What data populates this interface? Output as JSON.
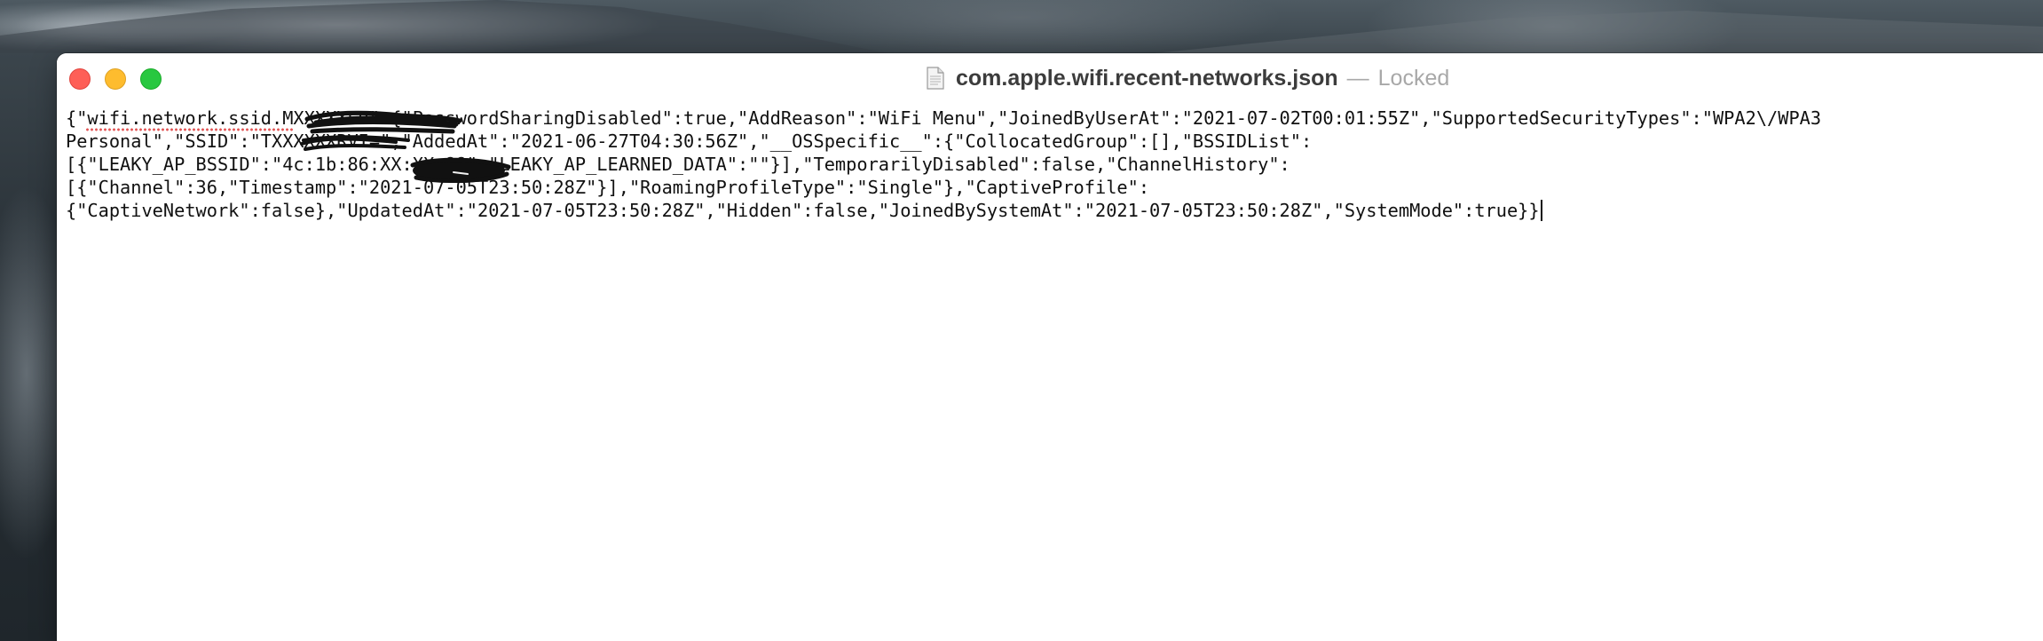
{
  "window": {
    "filename": "com.apple.wifi.recent-networks.json",
    "separator": "—",
    "status": "Locked",
    "controls": {
      "close": "close-button",
      "minimize": "minimize-button",
      "zoom": "zoom-button"
    }
  },
  "editor": {
    "lines": [
      "{\"wifi.network.ssid.MXXXXXER\":{\"PasswordSharingDisabled\":true,\"AddReason\":\"WiFi Menu\",\"JoinedByUserAt\":\"2021-07-02T00:01:55Z\",\"SupportedSecurityTypes\":\"WPA2\\/WPA3",
      "Personal\",\"SSID\":\"TXXXXXXRVI=\",\"AddedAt\":\"2021-06-27T04:30:56Z\",\"__OSSpecific__\":{\"CollocatedGroup\":[],\"BSSIDList\":",
      "[{\"LEAKY_AP_BSSID\":\"4c:1b:86:XX:XX:88\",\"LEAKY_AP_LEARNED_DATA\":\"\"}],\"TemporarilyDisabled\":false,\"ChannelHistory\":",
      "[{\"Channel\":36,\"Timestamp\":\"2021-07-05T23:50:28Z\"}],\"RoamingProfileType\":\"Single\"},\"CaptiveProfile\":",
      "{\"CaptiveNetwork\":false},\"UpdatedAt\":\"2021-07-05T23:50:28Z\",\"Hidden\":false,\"JoinedBySystemAt\":\"2021-07-05T23:50:28Z\",\"SystemMode\":true}}"
    ]
  },
  "colors": {
    "close": "#fe5f57",
    "minimize": "#febc2e",
    "zoom": "#28c840",
    "text": "#111111",
    "spell_underline": "#e25656"
  },
  "icons": {
    "document": "document-icon"
  }
}
